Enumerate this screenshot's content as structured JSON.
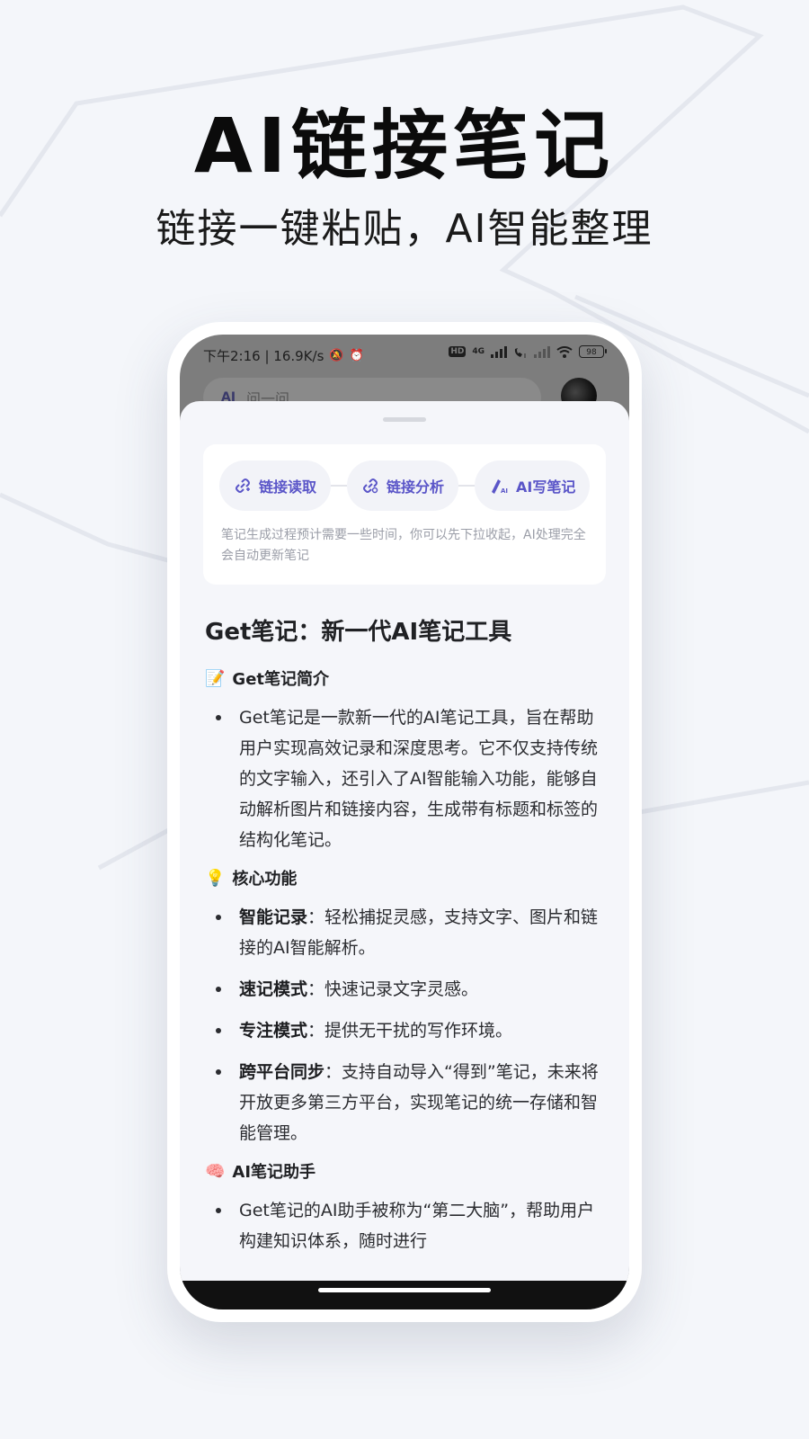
{
  "promo": {
    "title": "AI链接笔记",
    "subtitle": "链接一键粘贴，AI智能整理"
  },
  "status_bar": {
    "time_text": "下午2:16 | 16.9K/s",
    "mute_icon": "muted-bell-icon",
    "alarm_icon": "alarm-clock-icon",
    "hd_badge": "HD",
    "network_label": "4G",
    "battery_level": "98"
  },
  "app_header": {
    "ai_badge": "AI",
    "search_placeholder": "问一问"
  },
  "steps": {
    "items": [
      {
        "label": "链接读取",
        "icon": "link-read-icon"
      },
      {
        "label": "链接分析",
        "icon": "link-analyze-icon"
      },
      {
        "label": "AI写笔记",
        "icon": "ai-pen-icon"
      }
    ],
    "note": "笔记生成过程预计需要一些时间，你可以先下拉收起，AI处理完全会自动更新笔记"
  },
  "note": {
    "title": "Get笔记：新一代AI笔记工具",
    "sections": [
      {
        "emoji": "📝",
        "heading": "Get笔记简介",
        "bullets": [
          {
            "bold": "",
            "text": "Get笔记是一款新一代的AI笔记工具，旨在帮助用户实现高效记录和深度思考。它不仅支持传统的文字输入，还引入了AI智能输入功能，能够自动解析图片和链接内容，生成带有标题和标签的结构化笔记。"
          }
        ]
      },
      {
        "emoji": "💡",
        "heading": "核心功能",
        "bullets": [
          {
            "bold": "智能记录",
            "text": "：轻松捕捉灵感，支持文字、图片和链接的AI智能解析。"
          },
          {
            "bold": "速记模式",
            "text": "：快速记录文字灵感。"
          },
          {
            "bold": "专注模式",
            "text": "：提供无干扰的写作环境。"
          },
          {
            "bold": "跨平台同步",
            "text": "：支持自动导入“得到”笔记，未来将开放更多第三方平台，实现笔记的统一存储和智能管理。"
          }
        ]
      },
      {
        "emoji": "🧠",
        "heading": "AI笔记助手",
        "bullets": [
          {
            "bold": "",
            "text": "Get笔记的AI助手被称为“第二大脑”，帮助用户构建知识体系，随时进行"
          }
        ]
      }
    ]
  }
}
